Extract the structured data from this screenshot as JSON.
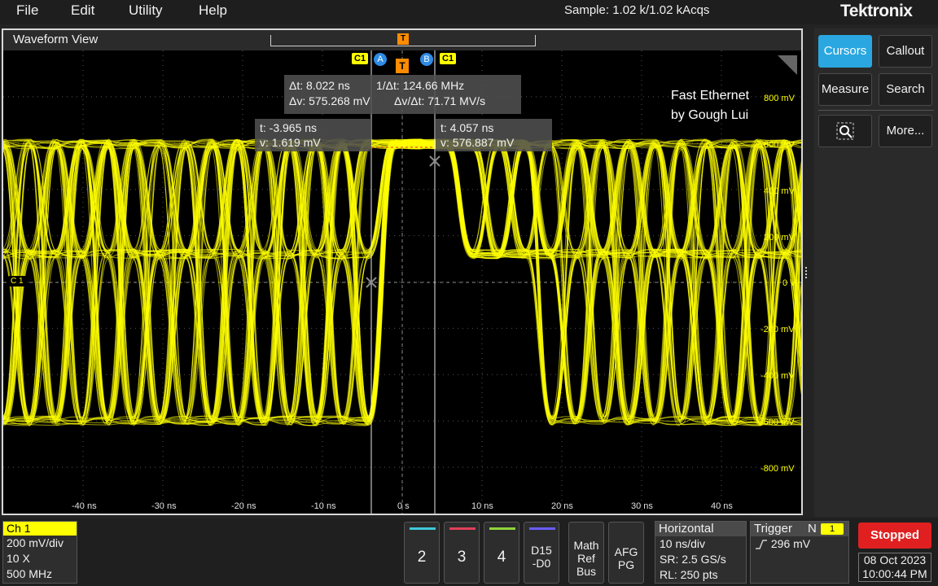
{
  "menu": {
    "items": [
      "File",
      "Edit",
      "Utility",
      "Help"
    ],
    "acquisition_status": "Sample: 1.02 k/1.02 kAcqs",
    "brand": "Tektronix"
  },
  "waveform_view": {
    "title": "Waveform View",
    "watermark_line1": "Fast Ethernet",
    "watermark_line2": "by Gough Lui",
    "channel_label": "C 1",
    "trigger_marker": "T",
    "cursor_a_label": "A",
    "cursor_b_label": "B",
    "cursor_source_a": "C1",
    "cursor_source_b": "C1",
    "y_axis_labels": [
      "800 mV",
      "600 mV",
      "400 mV",
      "200 mV",
      "0 V",
      "-200 mV",
      "-400 mV",
      "-600 mV",
      "-800 mV"
    ],
    "x_axis_labels": [
      "-40 ns",
      "-30 ns",
      "-20 ns",
      "-10 ns",
      "0 s",
      "10 ns",
      "20 ns",
      "30 ns",
      "40 ns"
    ],
    "delta_readout": {
      "dt": "Δt: 8.022 ns",
      "inv_dt": "1/Δt: 124.66 MHz",
      "dv": "Δv: 575.268 mV",
      "dv_dt": "Δv/Δt: 71.71 MV/s"
    },
    "cursor_a_readout": {
      "t": "t: -3.965 ns",
      "v": "v: 1.619 mV"
    },
    "cursor_b_readout": {
      "t": "t: 4.057 ns",
      "v": "v: 576.887 mV"
    },
    "trace_color": "#ffff00"
  },
  "side_panel": {
    "cursors": "Cursors",
    "callout": "Callout",
    "measure": "Measure",
    "search": "Search",
    "zoom_icon": "zoom-icon",
    "more": "More..."
  },
  "bottom": {
    "ch1": {
      "title": "Ch 1",
      "scale": "200 mV/div",
      "probe": "10 X",
      "bandwidth": "500 MHz"
    },
    "channels": [
      {
        "label": "2",
        "color": "#3fc8d8"
      },
      {
        "label": "3",
        "color": "#e0405a"
      },
      {
        "label": "4",
        "color": "#8fd43a"
      }
    ],
    "digital": {
      "line1": "D15",
      "line2": "-D0",
      "color": "#6a5cff"
    },
    "math_ref_bus": {
      "line1": "Math",
      "line2": "Ref",
      "line3": "Bus"
    },
    "afg_pg": {
      "line1": "AFG",
      "line2": "PG"
    },
    "horizontal": {
      "title": "Horizontal",
      "scale": "10 ns/div",
      "sample_rate": "SR: 2.5 GS/s",
      "record_length": "RL: 250 pts"
    },
    "trigger": {
      "title": "Trigger",
      "mode": "N",
      "source": "1",
      "level": "296 mV"
    },
    "run_state": "Stopped",
    "date": "08 Oct 2023",
    "time": "10:00:44 PM"
  }
}
